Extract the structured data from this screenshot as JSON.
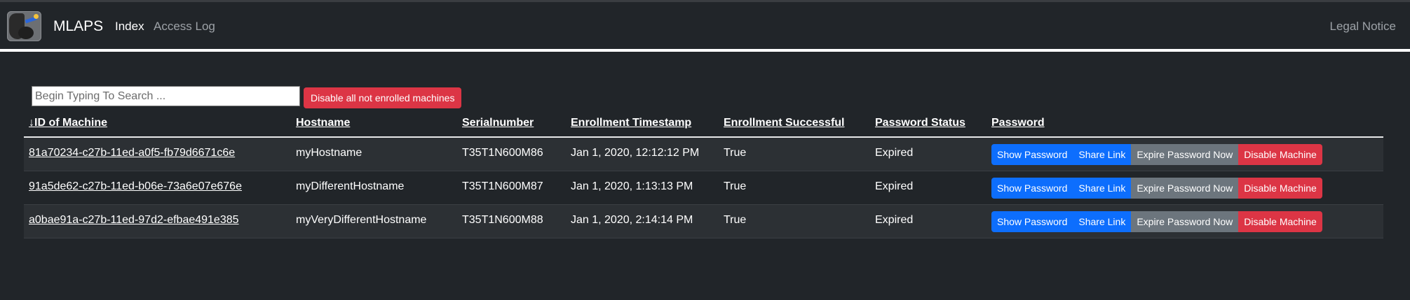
{
  "nav": {
    "brand": "MLAPS",
    "items": [
      {
        "label": "Index",
        "active": true
      },
      {
        "label": "Access Log",
        "active": false
      }
    ],
    "legal": "Legal Notice"
  },
  "toolbar": {
    "search_placeholder": "Begin Typing To Search ...",
    "search_value": "",
    "disable_all_label": "Disable all not enrolled machines"
  },
  "table": {
    "sort_indicator": "↓",
    "headers": [
      "ID of Machine",
      "Hostname",
      "Serialnumber",
      "Enrollment Timestamp",
      "Enrollment Successful",
      "Password Status",
      "Password"
    ],
    "rows": [
      {
        "id": "81a70234-c27b-11ed-a0f5-fb79d6671c6e",
        "hostname": "myHostname",
        "serial": "T35T1N600M86",
        "timestamp": "Jan 1, 2020, 12:12:12 PM",
        "successful": "True",
        "status": "Expired"
      },
      {
        "id": "91a5de62-c27b-11ed-b06e-73a6e07e676e",
        "hostname": "myDifferentHostname",
        "serial": "T35T1N600M87",
        "timestamp": "Jan 1, 2020, 1:13:13 PM",
        "successful": "True",
        "status": "Expired"
      },
      {
        "id": "a0bae91a-c27b-11ed-97d2-efbae491e385",
        "hostname": "myVeryDifferentHostname",
        "serial": "T35T1N600M88",
        "timestamp": "Jan 1, 2020, 2:14:14 PM",
        "successful": "True",
        "status": "Expired"
      }
    ],
    "actions": {
      "show_password": "Show Password",
      "share_link": "Share Link",
      "expire_password": "Expire Password Now",
      "disable_machine": "Disable Machine"
    }
  },
  "colors": {
    "background": "#212529",
    "primary": "#0d6efd",
    "secondary": "#6c757d",
    "danger": "#dc3545"
  }
}
